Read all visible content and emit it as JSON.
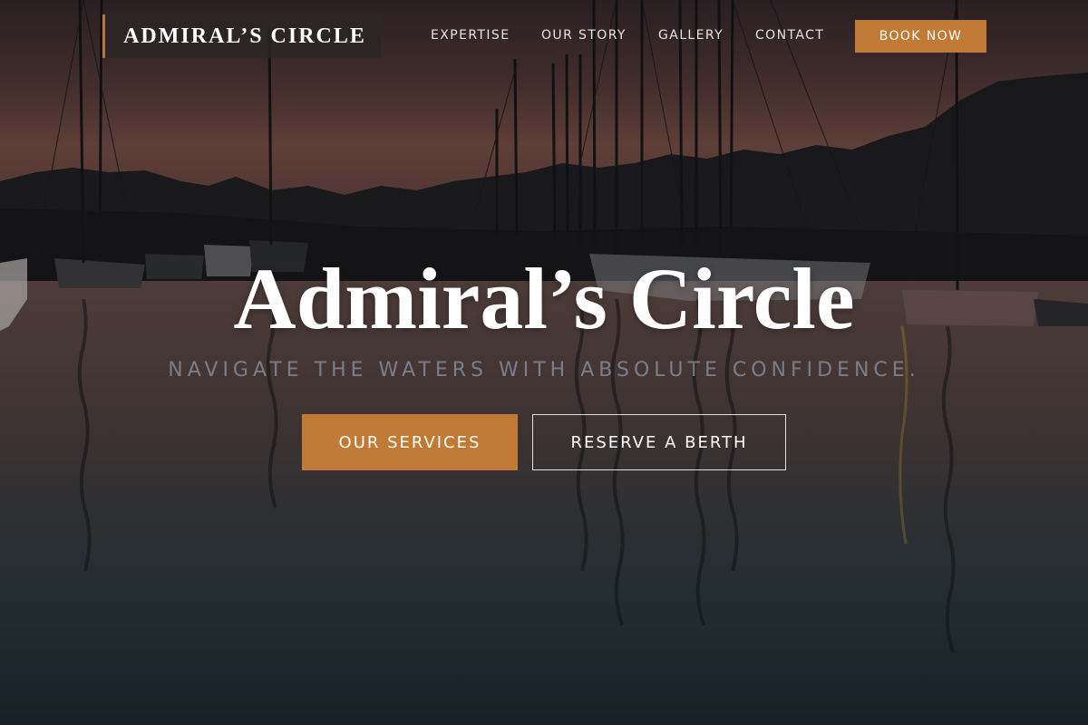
{
  "nav": {
    "brand": "ADMIRAL’S CIRCLE",
    "links": [
      {
        "label": "EXPERTISE"
      },
      {
        "label": "OUR STORY"
      },
      {
        "label": "GALLERY"
      },
      {
        "label": "CONTACT"
      }
    ],
    "cta_label": "BOOK NOW"
  },
  "hero": {
    "title": "Admiral’s Circle",
    "subtitle": "NAVIGATE THE WATERS WITH ABSOLUTE CONFIDENCE.",
    "primary_button": "OUR SERVICES",
    "secondary_button": "RESERVE A BERTH"
  },
  "colors": {
    "accent": "#c17a35",
    "brand_bg": "#2a2626",
    "text": "#ffffff"
  },
  "background": {
    "description_icon": "marina-sunset-photo"
  }
}
